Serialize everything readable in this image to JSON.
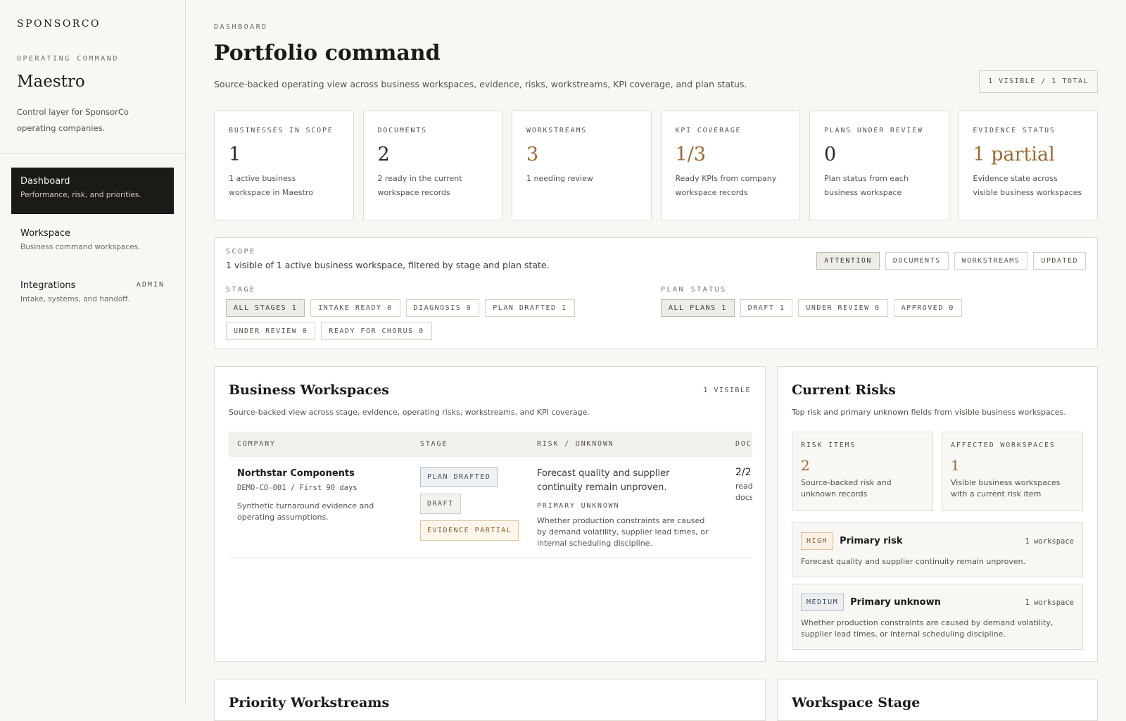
{
  "sidebar": {
    "brand": "SPONSORCO",
    "eyebrow": "OPERATING COMMAND",
    "title": "Maestro",
    "description": "Control layer for SponsorCo operating companies.",
    "nav": [
      {
        "label": "Dashboard",
        "sub": "Performance, risk, and priorities.",
        "active": true
      },
      {
        "label": "Workspace",
        "sub": "Business command workspaces."
      },
      {
        "label": "Integrations",
        "sub": "Intake, systems, and handoff.",
        "badge": "ADMIN"
      }
    ]
  },
  "header": {
    "eyebrow": "DASHBOARD",
    "title": "Portfolio command",
    "description": "Source-backed operating view across business workspaces, evidence, risks, workstreams, KPI coverage, and plan status.",
    "count": "1 VISIBLE / 1 TOTAL"
  },
  "kpis": [
    {
      "label": "BUSINESSES IN SCOPE",
      "value": "1",
      "sub": "1 active business workspace in Maestro"
    },
    {
      "label": "DOCUMENTS",
      "value": "2",
      "sub": "2 ready in the current workspace records"
    },
    {
      "label": "WORKSTREAMS",
      "value": "3",
      "sub": "1 needing review"
    },
    {
      "label": "KPI COVERAGE",
      "value": "1/3",
      "sub": "Ready KPIs from company workspace records"
    },
    {
      "label": "PLANS UNDER REVIEW",
      "value": "0",
      "sub": "Plan status from each business workspace"
    },
    {
      "label": "EVIDENCE STATUS",
      "value": "1 partial",
      "sub": "Evidence state across visible business workspaces"
    }
  ],
  "scope": {
    "eyebrow": "SCOPE",
    "text": "1 visible of 1 active business workspace, filtered by stage and plan state.",
    "sort_options": [
      "ATTENTION",
      "DOCUMENTS",
      "WORKSTREAMS",
      "UPDATED"
    ],
    "stage_label": "STAGE",
    "stages": [
      "ALL STAGES 1",
      "INTAKE READY 0",
      "DIAGNOSIS 0",
      "PLAN DRAFTED 1",
      "UNDER REVIEW 0",
      "READY FOR CHORUS 0"
    ],
    "plan_label": "PLAN STATUS",
    "plans": [
      "ALL PLANS 1",
      "DRAFT 1",
      "UNDER REVIEW 0",
      "APPROVED 0"
    ]
  },
  "workspaces": {
    "title": "Business Workspaces",
    "meta": "1 VISIBLE",
    "description": "Source-backed view across stage, evidence, operating risks, workstreams, and KPI coverage.",
    "columns": [
      "COMPANY",
      "STAGE",
      "RISK / UNKNOWN",
      "DOC"
    ],
    "rows": [
      {
        "name": "Northstar Components",
        "id": "DEMO-CO-001 / First 90 days",
        "desc": "Synthetic turnaround evidence and operating assumptions.",
        "tags": [
          "PLAN DRAFTED",
          "DRAFT",
          "EVIDENCE PARTIAL"
        ],
        "risk": "Forecast quality and supplier continuity remain unproven.",
        "unknown_label": "PRIMARY UNKNOWN",
        "unknown": "Whether production constraints are caused by demand volatility, supplier lead times, or internal scheduling discipline.",
        "docs": "2/2",
        "docs_sub": "ready docs"
      }
    ]
  },
  "risks": {
    "title": "Current Risks",
    "description": "Top risk and primary unknown fields from visible business workspaces.",
    "stats": [
      {
        "label": "RISK ITEMS",
        "value": "2",
        "sub": "Source-backed risk and unknown records"
      },
      {
        "label": "AFFECTED WORKSPACES",
        "value": "1",
        "sub": "Visible business workspaces with a current risk item"
      }
    ],
    "items": [
      {
        "severity": "HIGH",
        "title": "Primary risk",
        "meta": "1 workspace",
        "desc": "Forecast quality and supplier continuity remain unproven."
      },
      {
        "severity": "MEDIUM",
        "title": "Primary unknown",
        "meta": "1 workspace",
        "desc": "Whether production constraints are caused by demand volatility, supplier lead times, or internal scheduling discipline."
      }
    ]
  },
  "bottom": {
    "left_title": "Priority Workstreams",
    "right_title": "Workspace Stage"
  }
}
